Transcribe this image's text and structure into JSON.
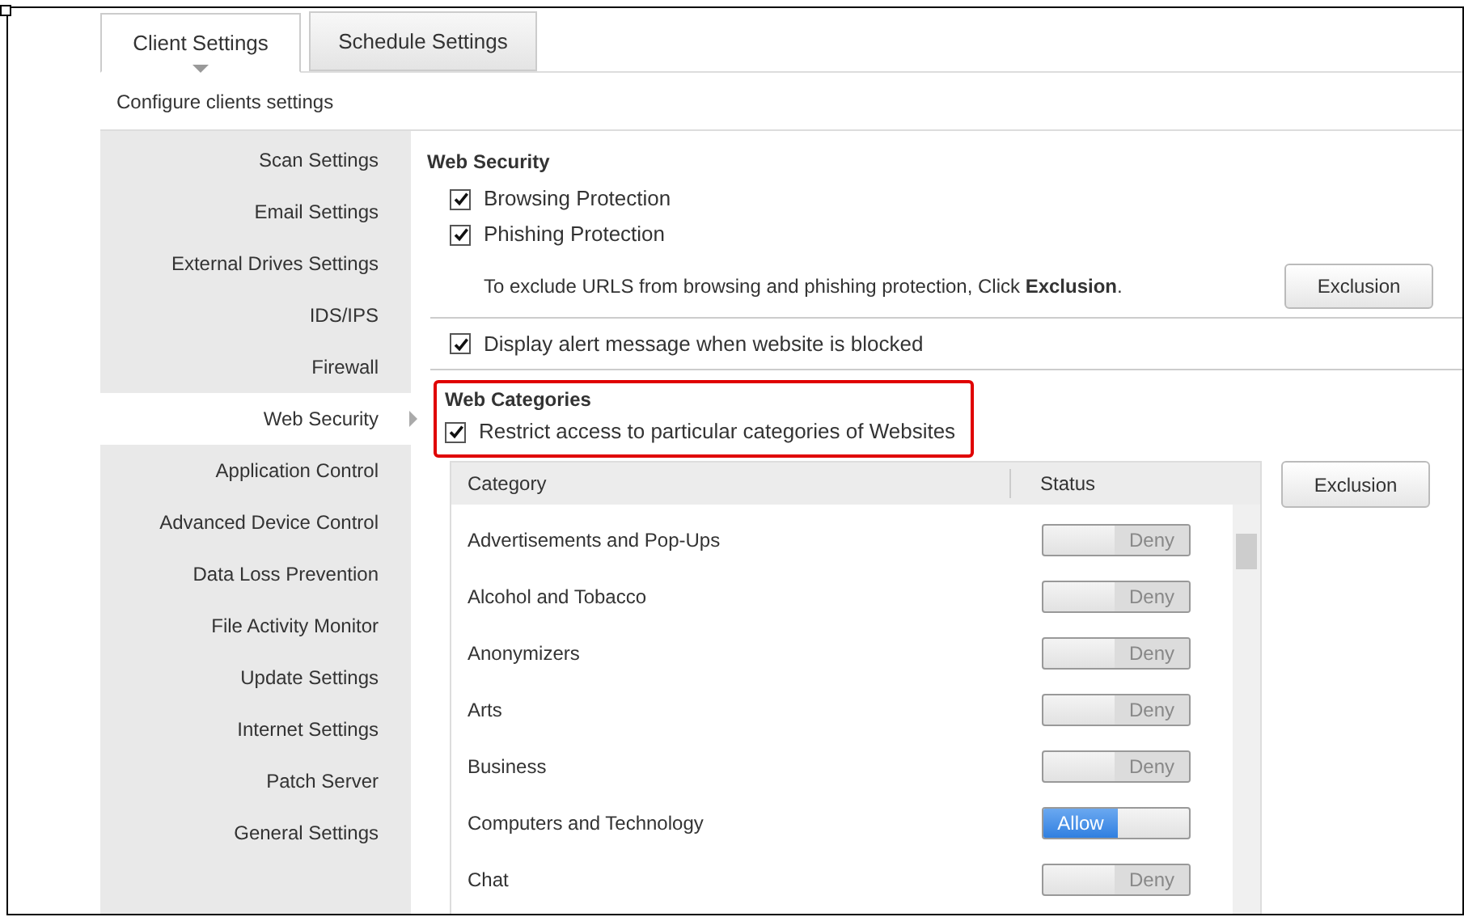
{
  "tabs": [
    {
      "label": "Client Settings",
      "selected": true
    },
    {
      "label": "Schedule Settings",
      "selected": false
    }
  ],
  "subtitle": "Configure clients settings",
  "sidebar": {
    "items": [
      {
        "label": "Scan Settings",
        "selected": false
      },
      {
        "label": "Email Settings",
        "selected": false
      },
      {
        "label": "External Drives Settings",
        "selected": false
      },
      {
        "label": "IDS/IPS",
        "selected": false
      },
      {
        "label": "Firewall",
        "selected": false
      },
      {
        "label": "Web Security",
        "selected": true
      },
      {
        "label": "Application Control",
        "selected": false
      },
      {
        "label": "Advanced Device Control",
        "selected": false
      },
      {
        "label": "Data Loss Prevention",
        "selected": false
      },
      {
        "label": "File Activity Monitor",
        "selected": false
      },
      {
        "label": "Update Settings",
        "selected": false
      },
      {
        "label": "Internet Settings",
        "selected": false
      },
      {
        "label": "Patch Server",
        "selected": false
      },
      {
        "label": "General Settings",
        "selected": false
      }
    ]
  },
  "web_security": {
    "title": "Web Security",
    "options": [
      {
        "label": "Browsing Protection",
        "checked": true
      },
      {
        "label": "Phishing Protection",
        "checked": true
      }
    ],
    "exclusion_note": "To exclude URLS from browsing and phishing protection, Click **Exclusion**.",
    "exclusion_button": "Exclusion",
    "alert_option": {
      "label": "Display alert message when website is blocked",
      "checked": true
    }
  },
  "web_categories": {
    "title": "Web Categories",
    "restrict_option": {
      "label": "Restrict access to particular categories of Websites",
      "checked": true
    },
    "exclusion_button": "Exclusion",
    "table": {
      "columns": [
        "Category",
        "Status"
      ],
      "rows": [
        {
          "category": "Advertisements and Pop-Ups",
          "status": "Deny",
          "allowed": false
        },
        {
          "category": "Alcohol and Tobacco",
          "status": "Deny",
          "allowed": false
        },
        {
          "category": "Anonymizers",
          "status": "Deny",
          "allowed": false
        },
        {
          "category": "Arts",
          "status": "Deny",
          "allowed": false
        },
        {
          "category": "Business",
          "status": "Deny",
          "allowed": false
        },
        {
          "category": "Computers and Technology",
          "status": "Allow",
          "allowed": true
        },
        {
          "category": "Chat",
          "status": "Deny",
          "allowed": false
        }
      ]
    }
  }
}
